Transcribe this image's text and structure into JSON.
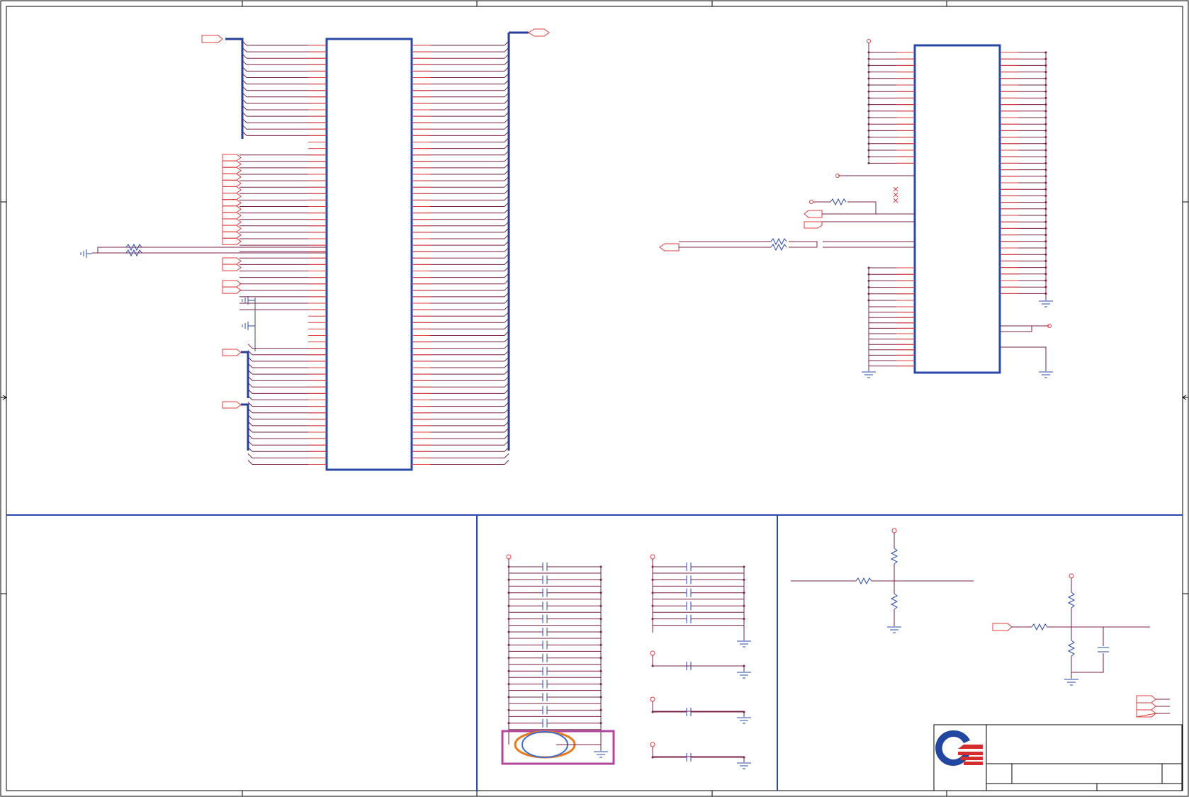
{
  "sheet": {
    "colors": {
      "border": "#000000",
      "block": "#2a48a8",
      "wire": "#7a1f45",
      "pin": "#e23c3c",
      "bus": "#2a3f9a",
      "highlight_box": "#b0479a",
      "highlight_ellipse_outer": "#e87a1c",
      "highlight_ellipse_inner": "#3d6fcf",
      "logo_blue": "#2147a0",
      "logo_red": "#d42d2d"
    }
  },
  "title_block": {
    "logo": "company-logo-icon",
    "title": "",
    "size": "",
    "document_number": "",
    "rev": "",
    "date": "",
    "sheet": ""
  }
}
